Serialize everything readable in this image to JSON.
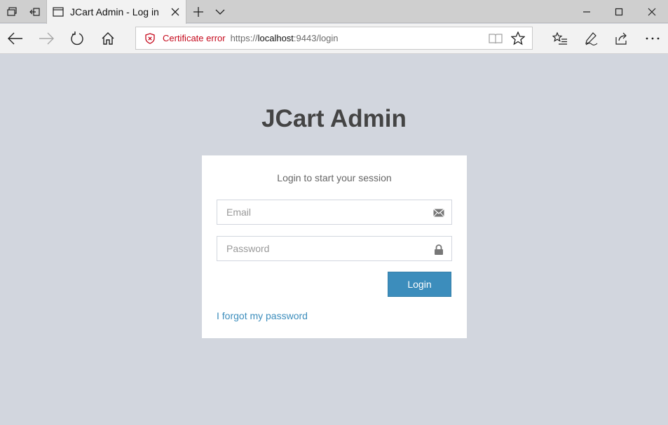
{
  "browser": {
    "tab_title": "JCart Admin - Log in",
    "cert_error_label": "Certificate error",
    "url_scheme": "https://",
    "url_host": "localhost",
    "url_rest": ":9443/login"
  },
  "page": {
    "title": "JCart Admin",
    "box_message": "Login to start your session",
    "email_placeholder": "Email",
    "password_placeholder": "Password",
    "login_label": "Login",
    "forgot_link": "I forgot my password"
  },
  "colors": {
    "page_background": "#d2d6de",
    "primary_button": "#3c8dbc",
    "link": "#3c8dbc",
    "cert_error": "#c5081b"
  },
  "icons": {
    "email": "envelope-icon",
    "password": "lock-icon"
  }
}
